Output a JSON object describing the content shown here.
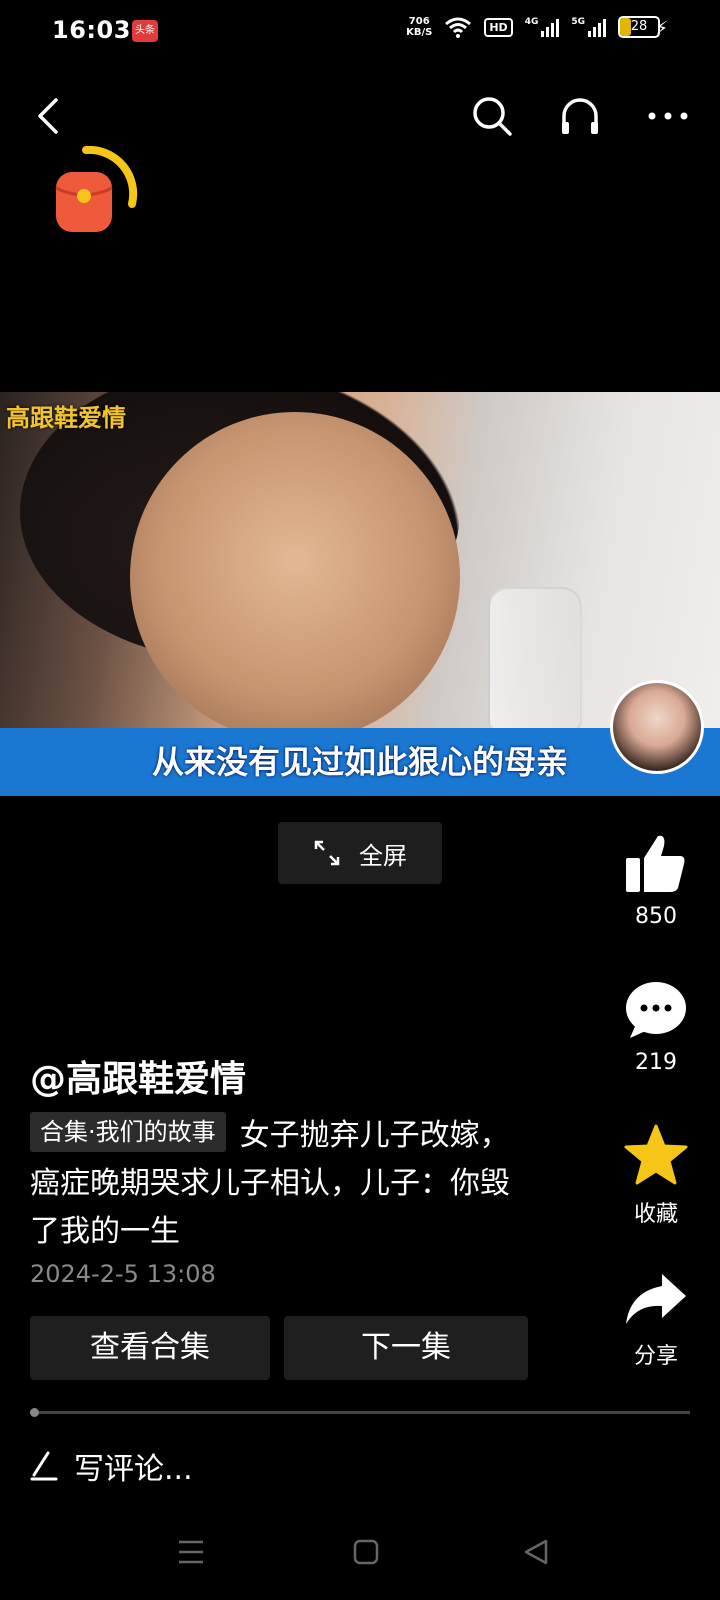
{
  "status_bar": {
    "time": "16:03",
    "app_badge": "头条",
    "speed_value": "706",
    "speed_unit": "KB/S",
    "hd_label": "HD",
    "net1": "4G",
    "net2": "5G",
    "battery": "28"
  },
  "video": {
    "watermark": "高跟鞋爱情",
    "subtitle": "从来没有见过如此狠心的母亲",
    "fullscreen_label": "全屏"
  },
  "actions": {
    "likes": "850",
    "comments": "219",
    "favorite_label": "收藏",
    "share_label": "分享"
  },
  "post": {
    "author": "@高跟鞋爱情",
    "collection_tag": "合集·我们的故事",
    "description": "女子抛弃儿子改嫁，癌症晚期哭求儿子相认，儿子：你毁了我的一生",
    "date": "2024-2-5 13:08",
    "view_collection_button": "查看合集",
    "next_episode_button": "下一集"
  },
  "comment_box": {
    "placeholder": "写评论..."
  },
  "colors": {
    "subtitle_bar": "#1a78d2",
    "watermark": "#f3c32b",
    "star": "#f5c518",
    "red_packet": "#ef5a3c"
  }
}
